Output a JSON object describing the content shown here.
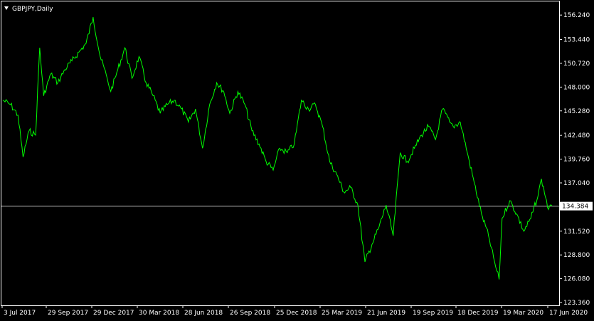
{
  "chart_window": {
    "symbol_label": "GBPJPY,Daily",
    "current_price_label": "134.384",
    "colors": {
      "background": "#000000",
      "line": "#00ff00",
      "axis": "#ffffff",
      "price_line": "#c0c0c0"
    },
    "icons": [
      "triangle-down-icon"
    ]
  },
  "chart_data": {
    "type": "line",
    "title": "GBPJPY,Daily",
    "ylim": [
      123.36,
      157.8
    ],
    "y_ticks": [
      156.24,
      153.44,
      150.72,
      148.0,
      145.28,
      142.48,
      139.76,
      137.04,
      134.384,
      131.52,
      128.8,
      126.08,
      123.36
    ],
    "y_tick_labels": [
      "156.240",
      "153.440",
      "150.720",
      "148.000",
      "145.280",
      "142.480",
      "139.760",
      "137.040",
      "134.384",
      "131.520",
      "128.800",
      "126.080",
      "123.360"
    ],
    "x_ticks": [
      "3 Jul 2017",
      "29 Sep 2017",
      "29 Dec 2017",
      "30 Mar 2018",
      "28 Jun 2018",
      "26 Sep 2018",
      "25 Dec 2018",
      "25 Mar 2019",
      "21 Jun 2019",
      "19 Sep 2019",
      "18 Dec 2019",
      "19 Mar 2020",
      "17 Jun 2020"
    ],
    "current_price": 134.384,
    "grid": false,
    "legend": "top-left",
    "series": [
      {
        "x": [
          "2017-07-03",
          "2017-07-18",
          "2017-08-02",
          "2017-08-12",
          "2017-08-24",
          "2017-09-06",
          "2017-09-14",
          "2017-09-22",
          "2017-10-06",
          "2017-10-20",
          "2017-11-03",
          "2017-11-17",
          "2017-12-01",
          "2017-12-15",
          "2017-12-29",
          "2018-01-12",
          "2018-01-26",
          "2018-02-02",
          "2018-02-16",
          "2018-03-02",
          "2018-03-16",
          "2018-03-30",
          "2018-04-13",
          "2018-04-27",
          "2018-05-11",
          "2018-05-25",
          "2018-06-08",
          "2018-06-22",
          "2018-07-06",
          "2018-07-20",
          "2018-08-03",
          "2018-08-17",
          "2018-08-31",
          "2018-09-14",
          "2018-09-26",
          "2018-10-12",
          "2018-10-26",
          "2018-11-09",
          "2018-11-23",
          "2018-12-07",
          "2018-12-21",
          "2019-01-03",
          "2019-01-18",
          "2019-02-01",
          "2019-02-15",
          "2019-03-01",
          "2019-03-15",
          "2019-03-29",
          "2019-04-12",
          "2019-04-26",
          "2019-05-10",
          "2019-05-24",
          "2019-06-07",
          "2019-06-21",
          "2019-07-05",
          "2019-07-19",
          "2019-08-02",
          "2019-08-16",
          "2019-08-30",
          "2019-09-13",
          "2019-09-27",
          "2019-10-11",
          "2019-10-25",
          "2019-11-08",
          "2019-11-22",
          "2019-12-06",
          "2019-12-13",
          "2019-12-27",
          "2020-01-10",
          "2020-01-24",
          "2020-02-07",
          "2020-02-21",
          "2020-03-06",
          "2020-03-13",
          "2020-03-19",
          "2020-04-03",
          "2020-04-17",
          "2020-05-01",
          "2020-05-15",
          "2020-05-29",
          "2020-06-05",
          "2020-06-19",
          "2020-06-26"
        ],
        "values": [
          146.5,
          146.0,
          144.8,
          140.0,
          143.0,
          142.5,
          152.5,
          147.0,
          149.5,
          148.5,
          150.0,
          151.0,
          152.0,
          153.0,
          156.0,
          151.5,
          149.0,
          147.5,
          150.0,
          152.5,
          149.0,
          151.5,
          148.5,
          147.0,
          145.0,
          146.0,
          146.5,
          145.5,
          144.0,
          145.5,
          141.0,
          146.0,
          148.5,
          147.5,
          145.0,
          147.5,
          146.0,
          143.0,
          141.5,
          139.5,
          138.5,
          141.0,
          140.5,
          141.5,
          146.5,
          145.5,
          146.0,
          143.5,
          139.5,
          138.0,
          136.0,
          136.5,
          134.5,
          128.0,
          130.0,
          132.0,
          134.5,
          131.0,
          140.5,
          139.5,
          141.0,
          142.5,
          143.5,
          142.0,
          145.5,
          144.0,
          143.5,
          144.0,
          140.5,
          137.0,
          133.5,
          131.0,
          127.5,
          126.0,
          133.0,
          135.0,
          133.5,
          131.5,
          133.0,
          135.5,
          137.5,
          134.0,
          134.4
        ]
      }
    ]
  }
}
